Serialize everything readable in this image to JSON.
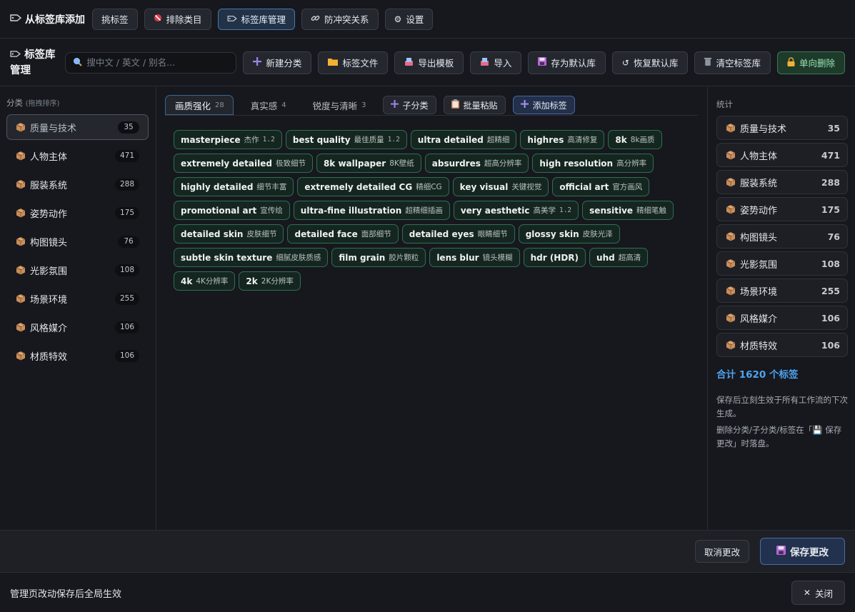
{
  "topbar": {
    "title": "从标签库添加",
    "tabs": [
      {
        "label": "挑标签",
        "icon": "",
        "active": false
      },
      {
        "label": "排除类目",
        "icon": "no-entry-icon",
        "active": false
      },
      {
        "label": "标签库管理",
        "icon": "tag-icon",
        "active": true
      },
      {
        "label": "防冲突关系",
        "icon": "link-icon",
        "active": false
      },
      {
        "label": "设置",
        "icon": "gear-icon",
        "active": false
      }
    ]
  },
  "toolbar": {
    "title": "标签库管理",
    "search_placeholder": "搜中文 / 英文 / 别名...",
    "new_category": "新建分类",
    "tag_file": "标签文件",
    "export_template": "导出模板",
    "import": "导入",
    "save_default": "存为默认库",
    "restore_default": "恢复默认库",
    "clear_library": "清空标签库",
    "single_delete": "单向删除"
  },
  "sidebar": {
    "heading": "分类",
    "heading_hint": "(拖拽排序)",
    "items": [
      {
        "name": "质量与技术",
        "count": "35"
      },
      {
        "name": "人物主体",
        "count": "471"
      },
      {
        "name": "服装系统",
        "count": "288"
      },
      {
        "name": "姿势动作",
        "count": "175"
      },
      {
        "name": "构图镜头",
        "count": "76"
      },
      {
        "name": "光影氛围",
        "count": "108"
      },
      {
        "name": "场景环境",
        "count": "255"
      },
      {
        "name": "风格媒介",
        "count": "106"
      },
      {
        "name": "材质特效",
        "count": "106"
      }
    ]
  },
  "main": {
    "subtabs": [
      {
        "label": "画质强化",
        "count": "28"
      },
      {
        "label": "真实感",
        "count": "4"
      },
      {
        "label": "锐度与清晰",
        "count": "3"
      }
    ],
    "add_subcategory": "子分类",
    "batch_paste": "批量粘贴",
    "add_tag": "添加标签",
    "tags": [
      {
        "en": "masterpiece",
        "zh": "杰作",
        "w": "1.2"
      },
      {
        "en": "best quality",
        "zh": "最佳质量",
        "w": "1.2"
      },
      {
        "en": "ultra detailed",
        "zh": "超精细",
        "w": ""
      },
      {
        "en": "highres",
        "zh": "高清修复",
        "w": ""
      },
      {
        "en": "8k",
        "zh": "8k画质",
        "w": ""
      },
      {
        "en": "extremely detailed",
        "zh": "极致细节",
        "w": ""
      },
      {
        "en": "8k wallpaper",
        "zh": "8K壁纸",
        "w": ""
      },
      {
        "en": "absurdres",
        "zh": "超高分辨率",
        "w": ""
      },
      {
        "en": "high resolution",
        "zh": "高分辨率",
        "w": ""
      },
      {
        "en": "highly detailed",
        "zh": "细节丰富",
        "w": ""
      },
      {
        "en": "extremely detailed CG",
        "zh": "精细CG",
        "w": ""
      },
      {
        "en": "key visual",
        "zh": "关键视觉",
        "w": ""
      },
      {
        "en": "official art",
        "zh": "官方画风",
        "w": ""
      },
      {
        "en": "promotional art",
        "zh": "宣传绘",
        "w": ""
      },
      {
        "en": "ultra-fine illustration",
        "zh": "超精细插画",
        "w": ""
      },
      {
        "en": "very aesthetic",
        "zh": "高美学",
        "w": "1.2"
      },
      {
        "en": "sensitive",
        "zh": "精细笔触",
        "w": ""
      },
      {
        "en": "detailed skin",
        "zh": "皮肤细节",
        "w": ""
      },
      {
        "en": "detailed face",
        "zh": "面部细节",
        "w": ""
      },
      {
        "en": "detailed eyes",
        "zh": "眼睛细节",
        "w": ""
      },
      {
        "en": "glossy skin",
        "zh": "皮肤光泽",
        "w": ""
      },
      {
        "en": "subtle skin texture",
        "zh": "细腻皮肤质感",
        "w": ""
      },
      {
        "en": "film grain",
        "zh": "胶片颗粒",
        "w": ""
      },
      {
        "en": "lens blur",
        "zh": "镜头模糊",
        "w": ""
      },
      {
        "en": "hdr (HDR)",
        "zh": "",
        "w": ""
      },
      {
        "en": "uhd",
        "zh": "超高清",
        "w": ""
      },
      {
        "en": "4k",
        "zh": "4K分辨率",
        "w": ""
      },
      {
        "en": "2k",
        "zh": "2K分辨率",
        "w": ""
      }
    ]
  },
  "stats": {
    "heading": "统计",
    "items": [
      {
        "name": "质量与技术",
        "count": "35"
      },
      {
        "name": "人物主体",
        "count": "471"
      },
      {
        "name": "服装系统",
        "count": "288"
      },
      {
        "name": "姿势动作",
        "count": "175"
      },
      {
        "name": "构图镜头",
        "count": "76"
      },
      {
        "name": "光影氛围",
        "count": "108"
      },
      {
        "name": "场景环境",
        "count": "255"
      },
      {
        "name": "风格媒介",
        "count": "106"
      },
      {
        "name": "材质特效",
        "count": "106"
      }
    ],
    "total": "合计 1620 个标签",
    "note1": "保存后立刻生效于所有工作流的下次生成。",
    "note2": "删除分类/子分类/标签在「💾 保存更改」时落盘。"
  },
  "actions": {
    "cancel": "取消更改",
    "save": "保存更改"
  },
  "footer": {
    "message": "管理页改动保存后全局生效",
    "close": "关闭"
  },
  "colors": {
    "tag_border": "#2e6f53",
    "accent_blue": "#4ea3f0",
    "box_icon": "#c98e5a"
  }
}
